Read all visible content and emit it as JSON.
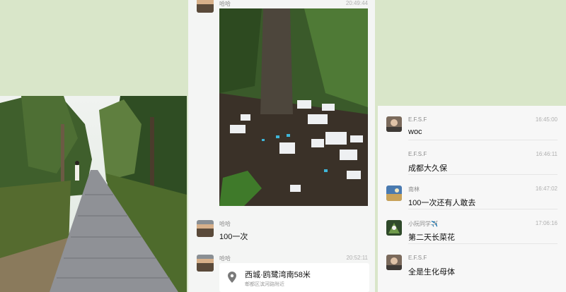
{
  "left_photo": {
    "description_icon": "park-path-photo"
  },
  "mid_chat": {
    "top_message": {
      "sender": "哈哈",
      "time": "20:49:44",
      "image_icon": "trash-under-tree-photo"
    },
    "message2": {
      "sender": "哈哈",
      "text": "100一次"
    },
    "message3": {
      "sender": "哈哈",
      "time": "20:52:11",
      "location": {
        "name": "西城·鸥鹭湾南58米",
        "address": "郫都区滨河路附近",
        "icon": "map-pin-icon"
      }
    }
  },
  "right_chat": {
    "messages": [
      {
        "sender": "E.F.S.F",
        "time": "16:45:00",
        "text": "woc"
      },
      {
        "sender": "E.F.S.F",
        "time": "16:46:11",
        "text": "成都大久保"
      },
      {
        "sender": "南林",
        "time": "16:47:02",
        "text": "100一次还有人敢去"
      },
      {
        "sender": "小阮同学✈️",
        "time": "17:06:16",
        "text": "第二天长菜花"
      },
      {
        "sender": "E.F.S.F",
        "time": "",
        "text": "全是生化母体"
      }
    ]
  }
}
